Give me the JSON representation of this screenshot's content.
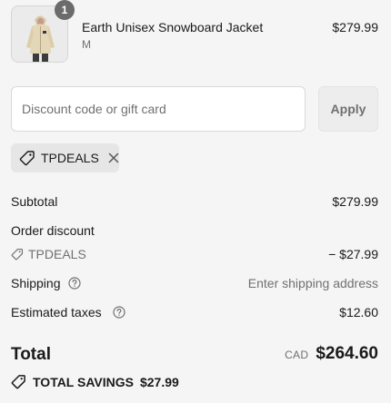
{
  "product": {
    "quantity": "1",
    "name": "Earth Unisex Snowboard Jacket",
    "variant": "M",
    "price": "$279.99",
    "image_icon": "jacket-icon"
  },
  "discount": {
    "placeholder": "Discount code or gift card",
    "value": "",
    "apply_label": "Apply",
    "applied_code": "TPDEALS"
  },
  "summary": {
    "subtotal_label": "Subtotal",
    "subtotal_value": "$279.99",
    "order_discount_label": "Order discount",
    "order_discount_code": "TPDEALS",
    "order_discount_value": "− $27.99",
    "shipping_label": "Shipping",
    "shipping_value": "Enter shipping address",
    "taxes_label": "Estimated taxes",
    "taxes_value": "$12.60"
  },
  "total": {
    "label": "Total",
    "currency": "CAD",
    "amount": "$264.60",
    "savings_label": "TOTAL SAVINGS",
    "savings_value": "$27.99"
  },
  "colors": {
    "background": "#f5f5f5",
    "text": "#1a1a1a",
    "muted": "#707070",
    "badge": "#6b6b6b",
    "jacket": "#e3d7b8"
  }
}
